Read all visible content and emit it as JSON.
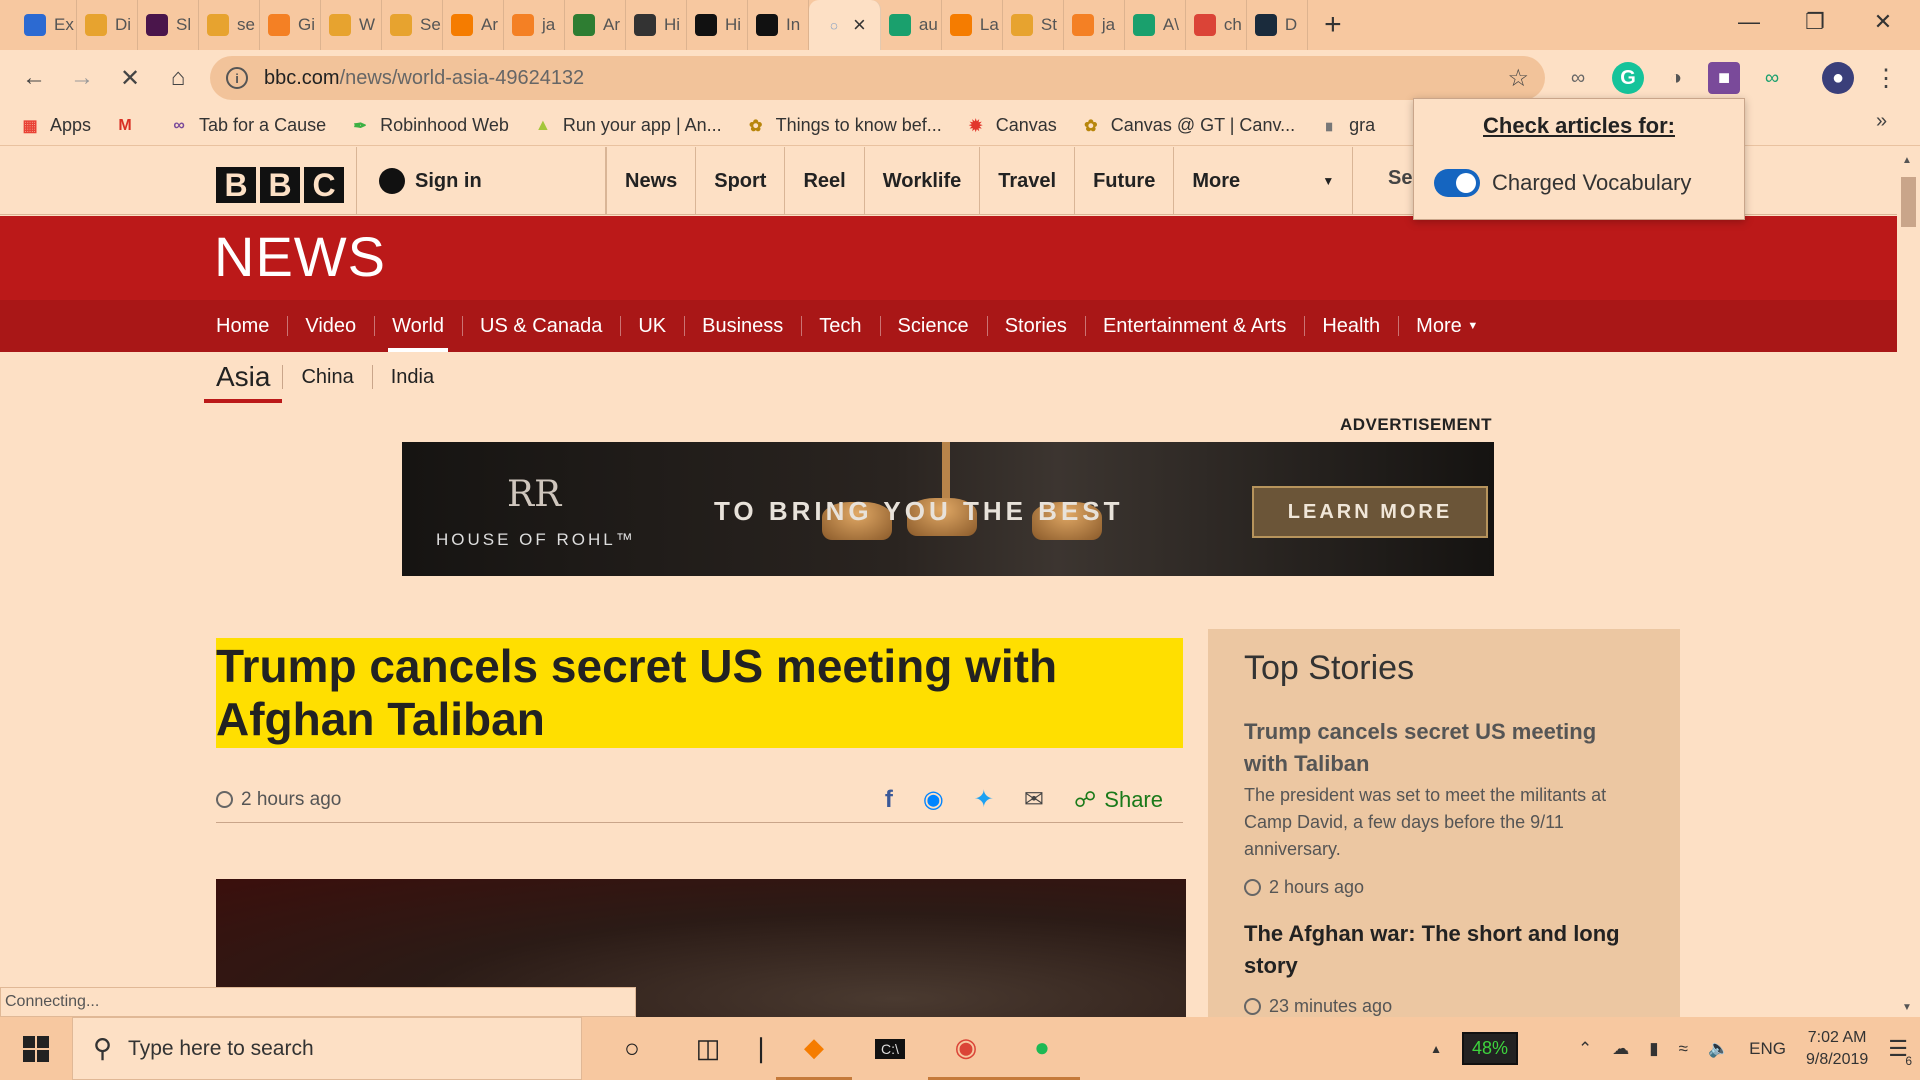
{
  "browser": {
    "tabs": [
      {
        "label": "Ex",
        "icon": "puzzle-icon",
        "color": "#2c6ad2"
      },
      {
        "label": "Di",
        "icon": "box-icon",
        "color": "#e7a32f"
      },
      {
        "label": "Sl",
        "icon": "slack-icon",
        "color": "#4a154b"
      },
      {
        "label": "se",
        "icon": "box-icon",
        "color": "#e7a32f"
      },
      {
        "label": "Gi",
        "icon": "stack-icon",
        "color": "#f48024"
      },
      {
        "label": "W",
        "icon": "box-icon",
        "color": "#e7a32f"
      },
      {
        "label": "Se",
        "icon": "box-icon",
        "color": "#e7a32f"
      },
      {
        "label": "Ar",
        "icon": "cube-icon",
        "color": "#f57c00"
      },
      {
        "label": "ja",
        "icon": "stack-icon",
        "color": "#f48024"
      },
      {
        "label": "Ar",
        "icon": "eye-icon",
        "color": "#2e7d32"
      },
      {
        "label": "Hi",
        "icon": "diamond-icon",
        "color": "#333333"
      },
      {
        "label": "Hi",
        "icon": "bn-icon",
        "color": "#111111"
      },
      {
        "label": "In",
        "icon": "medium-icon",
        "color": "#111111"
      }
    ],
    "active_tab_close": "×",
    "tabs_after": [
      {
        "label": "au",
        "icon": "loop-icon",
        "color": "#1aa06d"
      },
      {
        "label": "La",
        "icon": "lambda-icon",
        "color": "#f57c00"
      },
      {
        "label": "St",
        "icon": "box-icon",
        "color": "#e7a32f"
      },
      {
        "label": "ja",
        "icon": "stack-icon",
        "color": "#f48024"
      },
      {
        "label": "A\\",
        "icon": "loop-icon",
        "color": "#1aa06d"
      },
      {
        "label": "ch",
        "icon": "chrome-icon",
        "color": "#db4437"
      },
      {
        "label": "D",
        "icon": "d-icon",
        "color": "#1a2b3c"
      }
    ],
    "new_tab": "+",
    "url_host": "bbc.com",
    "url_path": "/news/world-asia-49624132"
  },
  "bookmarks": [
    {
      "label": "Apps",
      "icon": "apps-grid-icon"
    },
    {
      "label": "",
      "icon": "gmail-icon"
    },
    {
      "label": "Tab for a Cause",
      "icon": "tfac-icon"
    },
    {
      "label": "Robinhood Web",
      "icon": "feather-icon"
    },
    {
      "label": "Run your app  |  An...",
      "icon": "android-icon"
    },
    {
      "label": "Things to know bef...",
      "icon": "bee-icon"
    },
    {
      "label": "Canvas",
      "icon": "canvas-icon"
    },
    {
      "label": "Canvas @ GT | Canv...",
      "icon": "bee-icon"
    },
    {
      "label": "gra",
      "icon": "grad-icon"
    }
  ],
  "bbc": {
    "logo": [
      "B",
      "B",
      "C"
    ],
    "signin": "Sign in",
    "topnav": [
      "News",
      "Sport",
      "Reel",
      "Worklife",
      "Travel",
      "Future"
    ],
    "more": "More",
    "search_stub": "Se",
    "news_word": "NEWS",
    "news_nav": [
      "Home",
      "Video",
      "World",
      "US & Canada",
      "UK",
      "Business",
      "Tech",
      "Science",
      "Stories",
      "Entertainment & Arts",
      "Health"
    ],
    "news_nav_more": "More",
    "subnav": [
      "Asia",
      "China",
      "India"
    ],
    "ad_label": "ADVERTISEMENT",
    "ad": {
      "monogram": "RR",
      "brand": "HOUSE OF ROHL",
      "tagline": "TO BRING YOU THE BEST",
      "cta": "LEARN MORE"
    },
    "headline": "Trump cancels secret US meeting with Afghan Taliban",
    "time": "2 hours ago",
    "share": "Share",
    "top_stories": {
      "title": "Top Stories",
      "story1_title": "Trump cancels secret US meeting with Taliban",
      "story1_summary": "The president was set to meet the militants at Camp David, a few days before the 9/11 anniversary.",
      "story1_time": "2 hours ago",
      "story2_title": "The Afghan war: The short and long story",
      "story2_time": "23 minutes ago"
    }
  },
  "popup": {
    "title": "Check articles for:",
    "option": "Charged Vocabulary",
    "enabled": true
  },
  "status_text": "Connecting...",
  "taskbar": {
    "search_placeholder": "Type here to search",
    "battery": "48%",
    "lang": "ENG",
    "time": "7:02 AM",
    "date": "9/8/2019",
    "notifications": "6"
  }
}
